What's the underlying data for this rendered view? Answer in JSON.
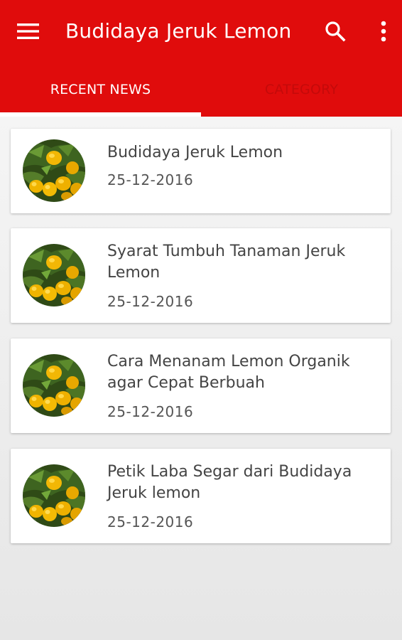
{
  "app": {
    "title": "Budidaya Jeruk Lemon",
    "accent_color": "#e00c0c"
  },
  "toolbar": {
    "menu_icon": "hamburger-menu-icon",
    "search_icon": "search-icon",
    "more_icon": "more-vert-icon"
  },
  "tabs": [
    {
      "label": "RECENT NEWS",
      "active": true
    },
    {
      "label": "CATEGORY",
      "active": false
    }
  ],
  "articles": [
    {
      "title": "Budidaya Jeruk Lemon",
      "date": "25-12-2016",
      "thumbnail": "lemon-tree-image"
    },
    {
      "title": "Syarat Tumbuh Tanaman Jeruk Lemon",
      "date": "25-12-2016",
      "thumbnail": "lemon-tree-image"
    },
    {
      "title": "Cara Menanam Lemon Organik agar Cepat Berbuah",
      "date": "25-12-2016",
      "thumbnail": "lemon-tree-image"
    },
    {
      "title": "Petik Laba Segar dari Budidaya Jeruk lemon",
      "date": "25-12-2016",
      "thumbnail": "lemon-tree-image"
    }
  ]
}
